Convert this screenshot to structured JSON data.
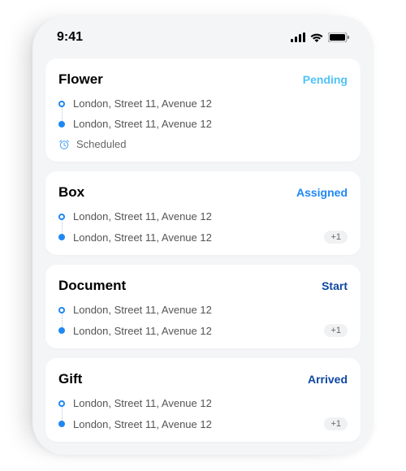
{
  "statusbar": {
    "time": "9:41"
  },
  "cards": [
    {
      "title": "Flower",
      "status": "Pending",
      "status_class": "status-pending",
      "stops": [
        {
          "label": "London, Street 11, Avenue 12"
        },
        {
          "label": "London, Street 11, Avenue 12"
        }
      ],
      "scheduled": "Scheduled"
    },
    {
      "title": "Box",
      "status": "Assigned",
      "status_class": "status-assigned",
      "stops": [
        {
          "label": "London, Street 11, Avenue 12"
        },
        {
          "label": "London, Street 11, Avenue 12",
          "extra": "+1"
        }
      ]
    },
    {
      "title": "Document",
      "status": "Start",
      "status_class": "status-start",
      "stops": [
        {
          "label": "London, Street 11, Avenue 12"
        },
        {
          "label": "London, Street 11, Avenue 12",
          "extra": "+1"
        }
      ]
    },
    {
      "title": "Gift",
      "status": "Arrived",
      "status_class": "status-arrived",
      "stops": [
        {
          "label": "London, Street 11, Avenue 12"
        },
        {
          "label": "London, Street 11, Avenue 12",
          "extra": "+1"
        }
      ]
    }
  ]
}
